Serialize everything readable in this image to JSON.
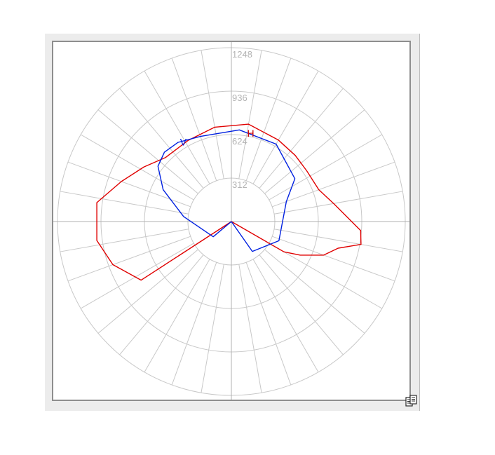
{
  "chart_data": {
    "type": "polar-line",
    "radial_ticks": [
      "312",
      "624",
      "936",
      "1248"
    ],
    "rmax": 1248,
    "grid": true,
    "angular_grid_step_deg": 10,
    "series": [
      {
        "name": "H",
        "color": "#e00000",
        "points": [
          {
            "angle": 0,
            "r": 0
          },
          {
            "angle": 60,
            "r": 435
          },
          {
            "angle": 64,
            "r": 550
          },
          {
            "angle": 70,
            "r": 705
          },
          {
            "angle": 76,
            "r": 790
          },
          {
            "angle": 80,
            "r": 945
          },
          {
            "angle": 86,
            "r": 930
          },
          {
            "angle": 100,
            "r": 745
          },
          {
            "angle": 110,
            "r": 668
          },
          {
            "angle": 124,
            "r": 652
          },
          {
            "angle": 136,
            "r": 660
          },
          {
            "angle": 150,
            "r": 675
          },
          {
            "angle": 170,
            "r": 710
          },
          {
            "angle": 190,
            "r": 688
          },
          {
            "angle": 208,
            "r": 660
          },
          {
            "angle": 226,
            "r": 660
          },
          {
            "angle": 238,
            "r": 740
          },
          {
            "angle": 250,
            "r": 840
          },
          {
            "angle": 262,
            "r": 975
          },
          {
            "angle": 278,
            "r": 975
          },
          {
            "angle": 290,
            "r": 905
          },
          {
            "angle": 303,
            "r": 772
          },
          {
            "angle": 360,
            "r": 0
          }
        ]
      },
      {
        "name": "V",
        "color": "#0020e0",
        "points": [
          {
            "angle": 0,
            "r": 0
          },
          {
            "angle": 35,
            "r": 262
          },
          {
            "angle": 68,
            "r": 368
          },
          {
            "angle": 110,
            "r": 420
          },
          {
            "angle": 124,
            "r": 550
          },
          {
            "angle": 150,
            "r": 642
          },
          {
            "angle": 175,
            "r": 660
          },
          {
            "angle": 200,
            "r": 650
          },
          {
            "angle": 214,
            "r": 685
          },
          {
            "angle": 224,
            "r": 692
          },
          {
            "angle": 233,
            "r": 660
          },
          {
            "angle": 245,
            "r": 540
          },
          {
            "angle": 264,
            "r": 345
          },
          {
            "angle": 310,
            "r": 170
          },
          {
            "angle": 360,
            "r": 0
          }
        ]
      }
    ],
    "annotations": [
      {
        "text": "H",
        "series": "H",
        "color": "#cc0000"
      },
      {
        "text": "V",
        "series": "V",
        "color": "#0020e0"
      }
    ]
  },
  "toolbar": {
    "copy_icon": "copy-report-icon"
  }
}
